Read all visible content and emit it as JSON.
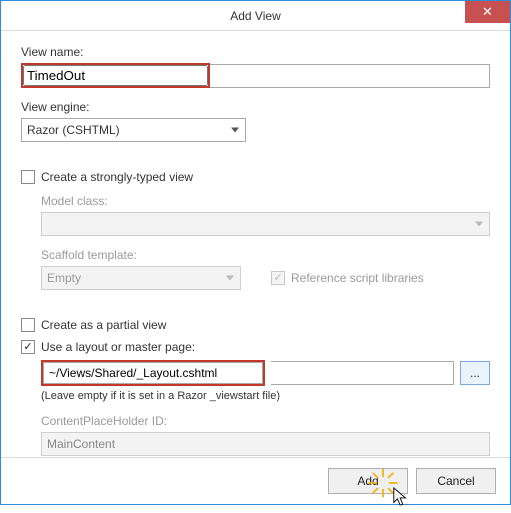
{
  "window": {
    "title": "Add View"
  },
  "labels": {
    "view_name": "View name:",
    "view_engine": "View engine:",
    "model_class": "Model class:",
    "scaffold_template": "Scaffold template:",
    "content_placeholder": "ContentPlaceHolder ID:"
  },
  "values": {
    "view_name": "TimedOut",
    "view_engine": "Razor (CSHTML)",
    "scaffold_template": "Empty",
    "layout_path": "~/Views/Shared/_Layout.cshtml",
    "content_placeholder": "MainContent"
  },
  "checkboxes": {
    "strongly_typed": "Create a strongly-typed view",
    "reference_scripts": "Reference script libraries",
    "partial_view": "Create as a partial view",
    "use_layout": "Use a layout or master page:"
  },
  "hints": {
    "layout": "(Leave empty if it is set in a Razor _viewstart file)"
  },
  "buttons": {
    "browse": "...",
    "add": "Add",
    "cancel": "Cancel"
  }
}
